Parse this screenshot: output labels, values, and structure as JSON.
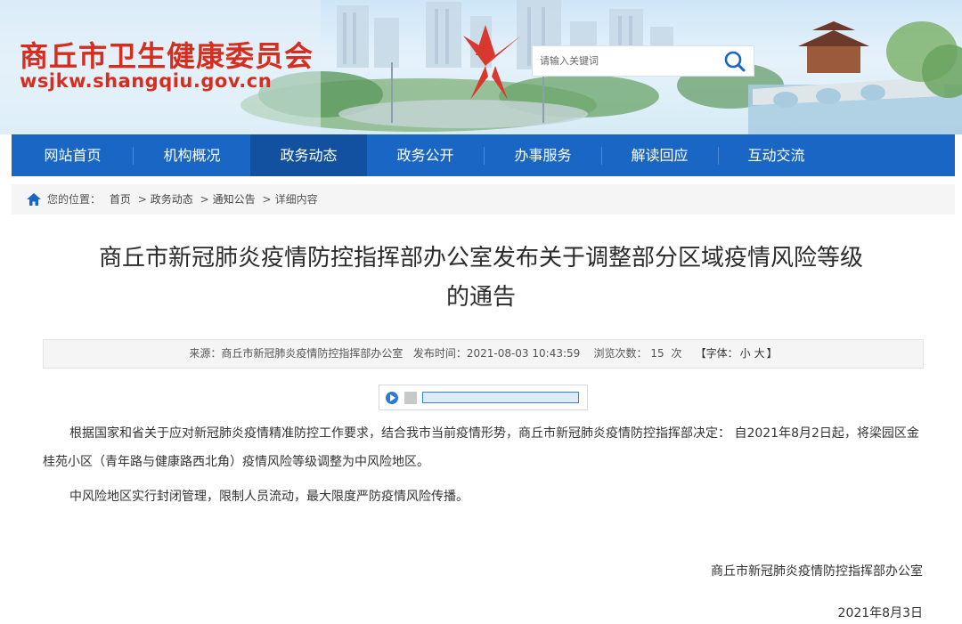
{
  "header": {
    "site_title": "商丘市卫生健康委员会",
    "site_url": "wsjkw.shangqiu.gov.cn",
    "search_placeholder": "请输入关键词"
  },
  "nav": {
    "items": [
      {
        "label": "网站首页"
      },
      {
        "label": "机构概况"
      },
      {
        "label": "政务动态",
        "active": true
      },
      {
        "label": "政务公开"
      },
      {
        "label": "办事服务"
      },
      {
        "label": "解读回应"
      },
      {
        "label": "互动交流"
      }
    ]
  },
  "breadcrumb": {
    "prefix": "您的位置：",
    "items": [
      "首页",
      "政务动态",
      "通知公告",
      "详细内容"
    ],
    "separator": ">"
  },
  "article": {
    "title_line1": "商丘市新冠肺炎疫情防控指挥部办公室发布关于调整部分区域疫情风险等级",
    "title_line2": "的通告",
    "meta": {
      "source_label": "来源：",
      "source": "商丘市新冠肺炎疫情防控指挥部办公室",
      "time_label": "发布时间：",
      "time": "2021-08-03 10:43:59",
      "views_label": "浏览次数：",
      "views": "15",
      "views_unit": "次",
      "font_label_open": "【字体：",
      "font_small": "小",
      "font_large": "大",
      "font_label_close": "】"
    },
    "paragraph1_line1": "根据国家和省关于应对新冠肺炎疫情精准防控工作要求，结合我市当前疫情形势，商丘市新冠肺炎疫情防控指挥部决定：  自2021年8月2日起，将梁园区金",
    "paragraph1_line2": "桂苑小区（青年路与健康路西北角）疫情风险等级调整为中风险地区。",
    "paragraph2": "中风险地区实行封闭管理，限制人员流动，最大限度严防疫情风险传播。",
    "signature": "商丘市新冠肺炎疫情防控指挥部办公室",
    "date": "2021年8月3日"
  },
  "colors": {
    "brand_red": "#d62d1f",
    "nav_blue": "#1a66c5",
    "nav_active": "#11519f"
  }
}
